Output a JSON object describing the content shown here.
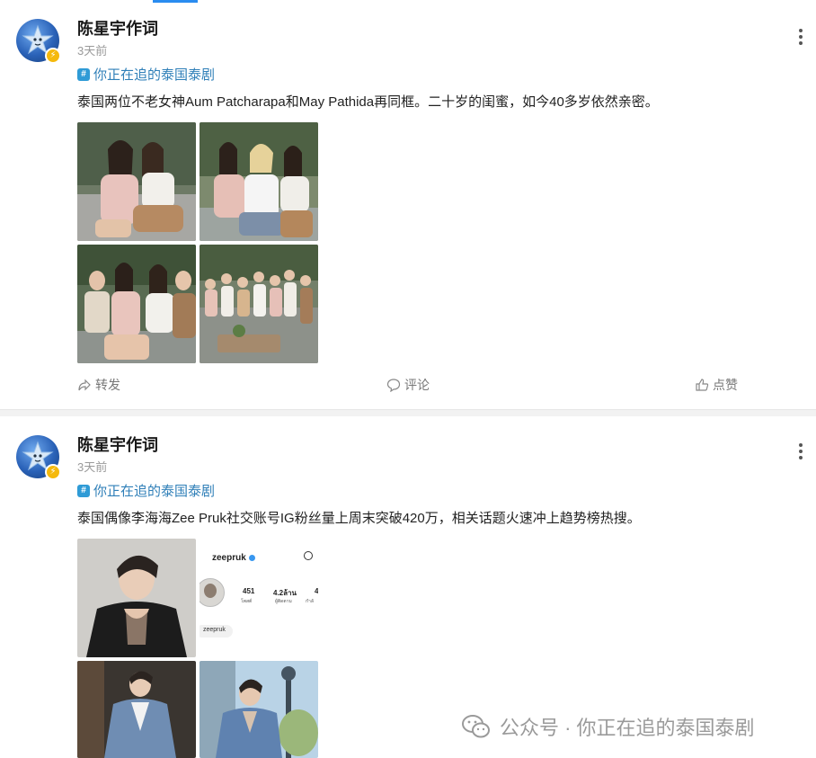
{
  "posts": [
    {
      "author": "陈星宇作词",
      "time": "3天前",
      "topic": "你正在追的泰国泰剧",
      "text": "泰国两位不老女神Aum Patcharapa和May Pathida再同框。二十岁的闺蜜，如今40多岁依然亲密。",
      "actions": {
        "repost": "转发",
        "comment": "评论",
        "like": "点赞"
      }
    },
    {
      "author": "陈星宇作词",
      "time": "3天前",
      "topic": "你正在追的泰国泰剧",
      "text": "泰国偶像李海海Zee Pruk社交账号IG粉丝量上周末突破420万，相关话题火速冲上趋势榜热搜。",
      "ig_profile": {
        "username": "zeepruk",
        "posts_count": "451",
        "posts_label": "โพสต์",
        "followers_count": "4.2ล้าน",
        "followers_label": "ผู้ติดตาม",
        "following_count": "4",
        "following_label": "กำลั",
        "handle_chip": "zeepruk"
      }
    }
  ],
  "watermark": "公众号 · 你正在追的泰国泰剧",
  "colors": {
    "accent": "#2a8cf0",
    "topic": "#2f7fb8",
    "badge": "#f5b90c"
  }
}
